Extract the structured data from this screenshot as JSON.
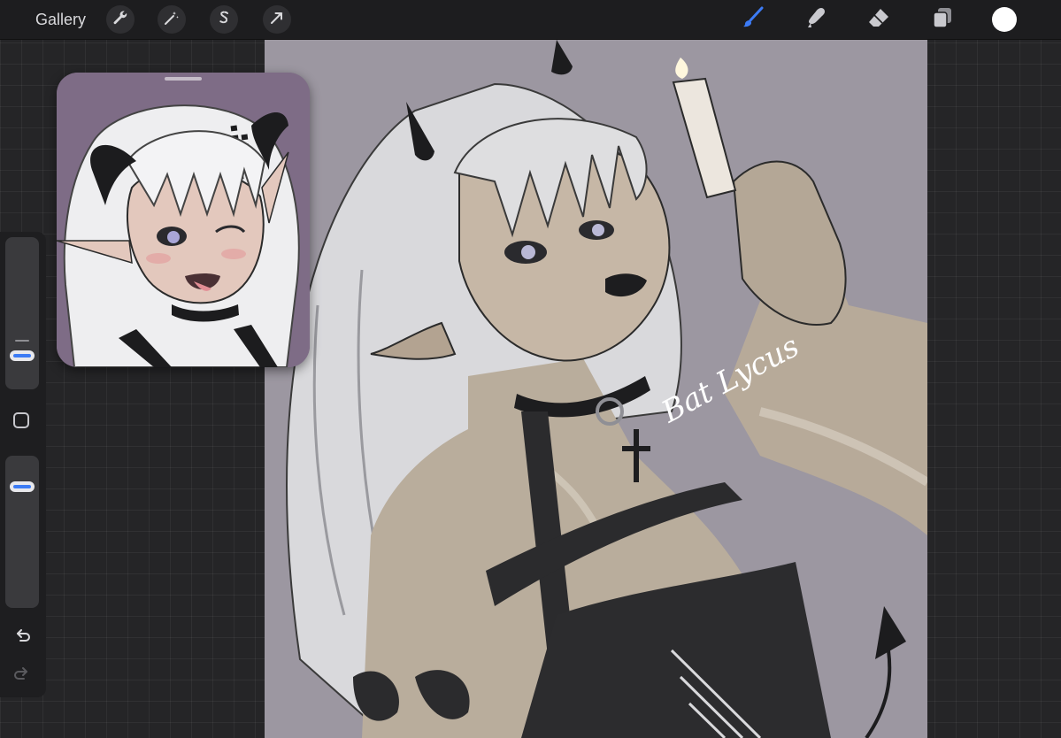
{
  "toolbar": {
    "gallery_label": "Gallery",
    "left_tools": [
      {
        "name": "actions",
        "icon": "wrench-icon"
      },
      {
        "name": "adjustments",
        "icon": "magic-wand-icon"
      },
      {
        "name": "selection",
        "icon": "selection-s-icon"
      },
      {
        "name": "transform",
        "icon": "arrow-cursor-icon"
      }
    ],
    "right_tools": [
      {
        "name": "brush",
        "icon": "brush-icon",
        "active": true
      },
      {
        "name": "smudge",
        "icon": "smudge-icon",
        "active": false
      },
      {
        "name": "eraser",
        "icon": "eraser-icon",
        "active": false
      },
      {
        "name": "layers",
        "icon": "layers-icon",
        "active": false
      }
    ],
    "active_color": "#ffffff",
    "accent_color": "#3c7bf5"
  },
  "canvas": {
    "signature": "Bat Lycus",
    "background_color": "#9c97a1"
  },
  "reference_window": {
    "background_color": "#7e6c86"
  },
  "sidebar": {
    "brush_size": 0.18,
    "brush_opacity": 0.84,
    "modify_button_icon": "square-icon",
    "undo_icon": "undo-icon",
    "redo_icon": "redo-icon"
  }
}
